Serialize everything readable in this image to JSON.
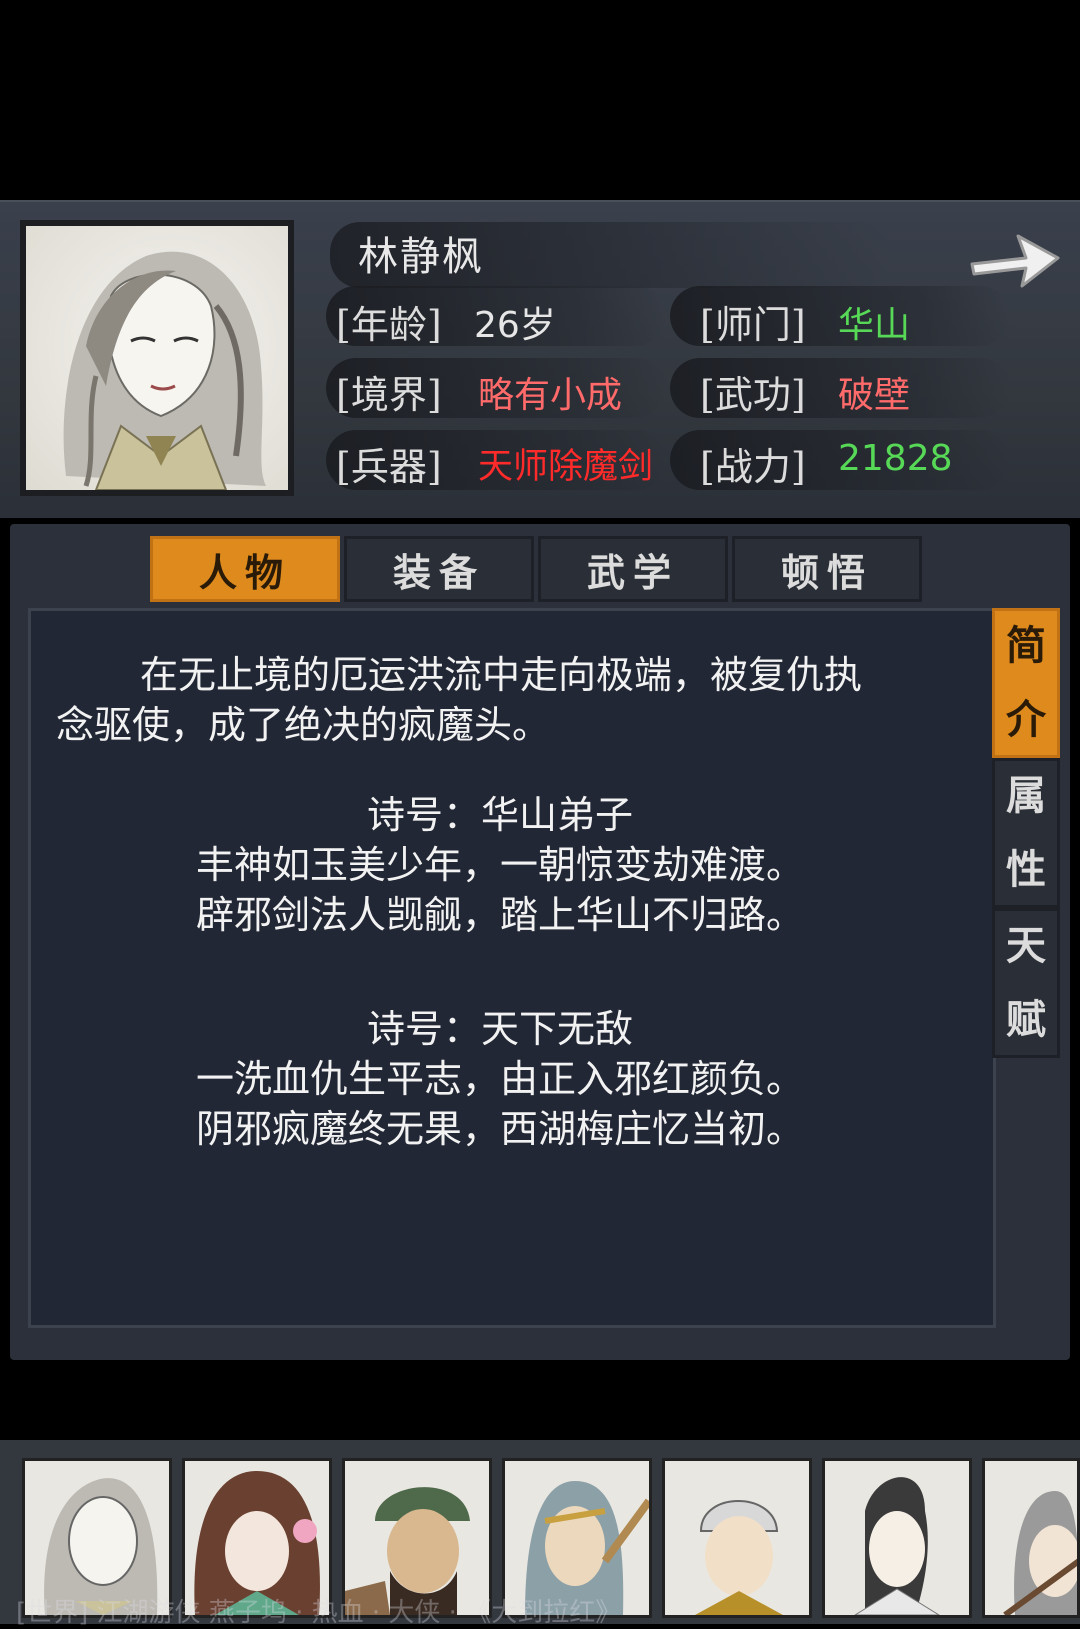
{
  "character": {
    "name": "林静枫",
    "stats": {
      "age_label": "[年龄]",
      "age": "26岁",
      "sect_label": "[师门]",
      "sect": "华山",
      "realm_label": "[境界]",
      "realm": "略有小成",
      "skill_label": "[武功]",
      "skill": "破壁",
      "weapon_label": "[兵器]",
      "weapon": "天师除魔剑",
      "power_label": "[战力]",
      "power": "21828"
    }
  },
  "colors": {
    "green": "#57d957",
    "red": "#ff6a6a",
    "weapon_red": "#ff2a2a",
    "accent": "#de8a1d"
  },
  "tabs": [
    "人物",
    "装备",
    "武学",
    "顿悟"
  ],
  "side_tabs": [
    {
      "line1": "简",
      "line2": "介"
    },
    {
      "line1": "属",
      "line2": "性"
    },
    {
      "line1": "天",
      "line2": "赋"
    }
  ],
  "intro": {
    "line1": "在无止境的厄运洪流中走向极端，被复仇执",
    "line2": "念驱使，成了绝决的疯魔头。"
  },
  "poems": [
    {
      "title": "诗号：华山弟子",
      "line1": "丰神如玉美少年，一朝惊变劫难渡。",
      "line2": "辟邪剑法人觊觎，踏上华山不归路。"
    },
    {
      "title": "诗号：天下无敌",
      "line1": "一洗血仇生平志，由正入邪红颜负。",
      "line2": "阴邪疯魔终无果，西湖梅庄忆当初。"
    }
  ],
  "roster": [
    "portrait-1",
    "portrait-2",
    "portrait-3",
    "portrait-4",
    "portrait-5",
    "portrait-6",
    "portrait-7"
  ],
  "scroll_text": "[世界] 江湖游侠 燕子坞 · 热血 · 大侠 · 《大到拉红》"
}
